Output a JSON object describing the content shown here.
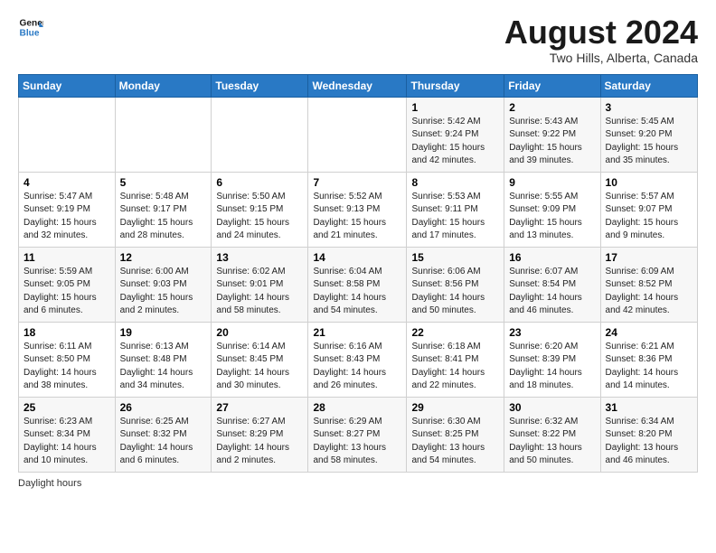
{
  "header": {
    "logo_line1": "General",
    "logo_line2": "Blue",
    "title": "August 2024",
    "subtitle": "Two Hills, Alberta, Canada"
  },
  "days_of_week": [
    "Sunday",
    "Monday",
    "Tuesday",
    "Wednesday",
    "Thursday",
    "Friday",
    "Saturday"
  ],
  "weeks": [
    [
      {
        "day": "",
        "info": ""
      },
      {
        "day": "",
        "info": ""
      },
      {
        "day": "",
        "info": ""
      },
      {
        "day": "",
        "info": ""
      },
      {
        "day": "1",
        "info": "Sunrise: 5:42 AM\nSunset: 9:24 PM\nDaylight: 15 hours\nand 42 minutes."
      },
      {
        "day": "2",
        "info": "Sunrise: 5:43 AM\nSunset: 9:22 PM\nDaylight: 15 hours\nand 39 minutes."
      },
      {
        "day": "3",
        "info": "Sunrise: 5:45 AM\nSunset: 9:20 PM\nDaylight: 15 hours\nand 35 minutes."
      }
    ],
    [
      {
        "day": "4",
        "info": "Sunrise: 5:47 AM\nSunset: 9:19 PM\nDaylight: 15 hours\nand 32 minutes."
      },
      {
        "day": "5",
        "info": "Sunrise: 5:48 AM\nSunset: 9:17 PM\nDaylight: 15 hours\nand 28 minutes."
      },
      {
        "day": "6",
        "info": "Sunrise: 5:50 AM\nSunset: 9:15 PM\nDaylight: 15 hours\nand 24 minutes."
      },
      {
        "day": "7",
        "info": "Sunrise: 5:52 AM\nSunset: 9:13 PM\nDaylight: 15 hours\nand 21 minutes."
      },
      {
        "day": "8",
        "info": "Sunrise: 5:53 AM\nSunset: 9:11 PM\nDaylight: 15 hours\nand 17 minutes."
      },
      {
        "day": "9",
        "info": "Sunrise: 5:55 AM\nSunset: 9:09 PM\nDaylight: 15 hours\nand 13 minutes."
      },
      {
        "day": "10",
        "info": "Sunrise: 5:57 AM\nSunset: 9:07 PM\nDaylight: 15 hours\nand 9 minutes."
      }
    ],
    [
      {
        "day": "11",
        "info": "Sunrise: 5:59 AM\nSunset: 9:05 PM\nDaylight: 15 hours\nand 6 minutes."
      },
      {
        "day": "12",
        "info": "Sunrise: 6:00 AM\nSunset: 9:03 PM\nDaylight: 15 hours\nand 2 minutes."
      },
      {
        "day": "13",
        "info": "Sunrise: 6:02 AM\nSunset: 9:01 PM\nDaylight: 14 hours\nand 58 minutes."
      },
      {
        "day": "14",
        "info": "Sunrise: 6:04 AM\nSunset: 8:58 PM\nDaylight: 14 hours\nand 54 minutes."
      },
      {
        "day": "15",
        "info": "Sunrise: 6:06 AM\nSunset: 8:56 PM\nDaylight: 14 hours\nand 50 minutes."
      },
      {
        "day": "16",
        "info": "Sunrise: 6:07 AM\nSunset: 8:54 PM\nDaylight: 14 hours\nand 46 minutes."
      },
      {
        "day": "17",
        "info": "Sunrise: 6:09 AM\nSunset: 8:52 PM\nDaylight: 14 hours\nand 42 minutes."
      }
    ],
    [
      {
        "day": "18",
        "info": "Sunrise: 6:11 AM\nSunset: 8:50 PM\nDaylight: 14 hours\nand 38 minutes."
      },
      {
        "day": "19",
        "info": "Sunrise: 6:13 AM\nSunset: 8:48 PM\nDaylight: 14 hours\nand 34 minutes."
      },
      {
        "day": "20",
        "info": "Sunrise: 6:14 AM\nSunset: 8:45 PM\nDaylight: 14 hours\nand 30 minutes."
      },
      {
        "day": "21",
        "info": "Sunrise: 6:16 AM\nSunset: 8:43 PM\nDaylight: 14 hours\nand 26 minutes."
      },
      {
        "day": "22",
        "info": "Sunrise: 6:18 AM\nSunset: 8:41 PM\nDaylight: 14 hours\nand 22 minutes."
      },
      {
        "day": "23",
        "info": "Sunrise: 6:20 AM\nSunset: 8:39 PM\nDaylight: 14 hours\nand 18 minutes."
      },
      {
        "day": "24",
        "info": "Sunrise: 6:21 AM\nSunset: 8:36 PM\nDaylight: 14 hours\nand 14 minutes."
      }
    ],
    [
      {
        "day": "25",
        "info": "Sunrise: 6:23 AM\nSunset: 8:34 PM\nDaylight: 14 hours\nand 10 minutes."
      },
      {
        "day": "26",
        "info": "Sunrise: 6:25 AM\nSunset: 8:32 PM\nDaylight: 14 hours\nand 6 minutes."
      },
      {
        "day": "27",
        "info": "Sunrise: 6:27 AM\nSunset: 8:29 PM\nDaylight: 14 hours\nand 2 minutes."
      },
      {
        "day": "28",
        "info": "Sunrise: 6:29 AM\nSunset: 8:27 PM\nDaylight: 13 hours\nand 58 minutes."
      },
      {
        "day": "29",
        "info": "Sunrise: 6:30 AM\nSunset: 8:25 PM\nDaylight: 13 hours\nand 54 minutes."
      },
      {
        "day": "30",
        "info": "Sunrise: 6:32 AM\nSunset: 8:22 PM\nDaylight: 13 hours\nand 50 minutes."
      },
      {
        "day": "31",
        "info": "Sunrise: 6:34 AM\nSunset: 8:20 PM\nDaylight: 13 hours\nand 46 minutes."
      }
    ]
  ],
  "footer": {
    "note": "Daylight hours"
  }
}
